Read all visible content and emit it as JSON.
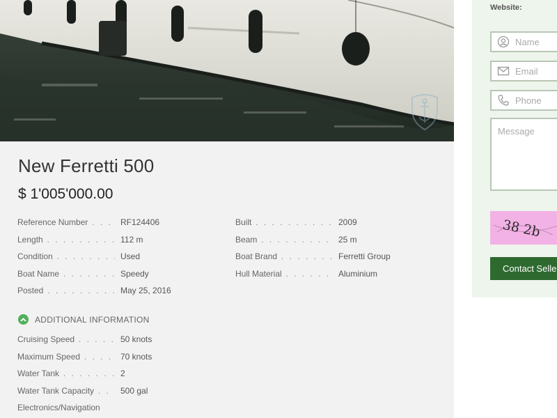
{
  "listing": {
    "title": "New Ferretti 500",
    "price": "$ 1'005'000.00"
  },
  "specs_left": [
    {
      "label": "Reference Number",
      "value": "RF124406"
    },
    {
      "label": "Length",
      "value": "112 m"
    },
    {
      "label": "Condition",
      "value": "Used"
    },
    {
      "label": "Boat Name",
      "value": "Speedy"
    },
    {
      "label": "Posted",
      "value": "May 25, 2016"
    }
  ],
  "specs_right": [
    {
      "label": "Built",
      "value": "2009"
    },
    {
      "label": "Beam",
      "value": "25 m"
    },
    {
      "label": "Boat Brand",
      "value": "Ferretti Group"
    },
    {
      "label": "Hull Material",
      "value": "Aluminium"
    }
  ],
  "additional": {
    "heading": "ADDITIONAL INFORMATION",
    "rows": [
      {
        "label": "Cruising Speed",
        "value": "50 knots"
      },
      {
        "label": "Maximum Speed",
        "value": "70 knots"
      },
      {
        "label": "Water Tank",
        "value": "2"
      },
      {
        "label": "Water Tank Capacity",
        "value": "500 gal"
      },
      {
        "label": "Electronics/Navigation",
        "value": ""
      }
    ]
  },
  "contact_form": {
    "website_label": "Website:",
    "name_placeholder": "Name",
    "email_placeholder": "Email",
    "phone_placeholder": "Phone",
    "message_placeholder": "Message",
    "captcha_text": "38 2b",
    "submit_label": "Contact Seller"
  },
  "icons": {
    "watermark": "anchor-shield-icon",
    "expand": "chevron-up-icon",
    "name": "user-icon",
    "email": "envelope-icon",
    "phone": "phone-icon"
  },
  "colors": {
    "accent_green": "#52b05c",
    "button_green": "#2e6a2f",
    "captcha_bg": "#f2b2e6",
    "sidebar_bg": "#eef5ec"
  }
}
